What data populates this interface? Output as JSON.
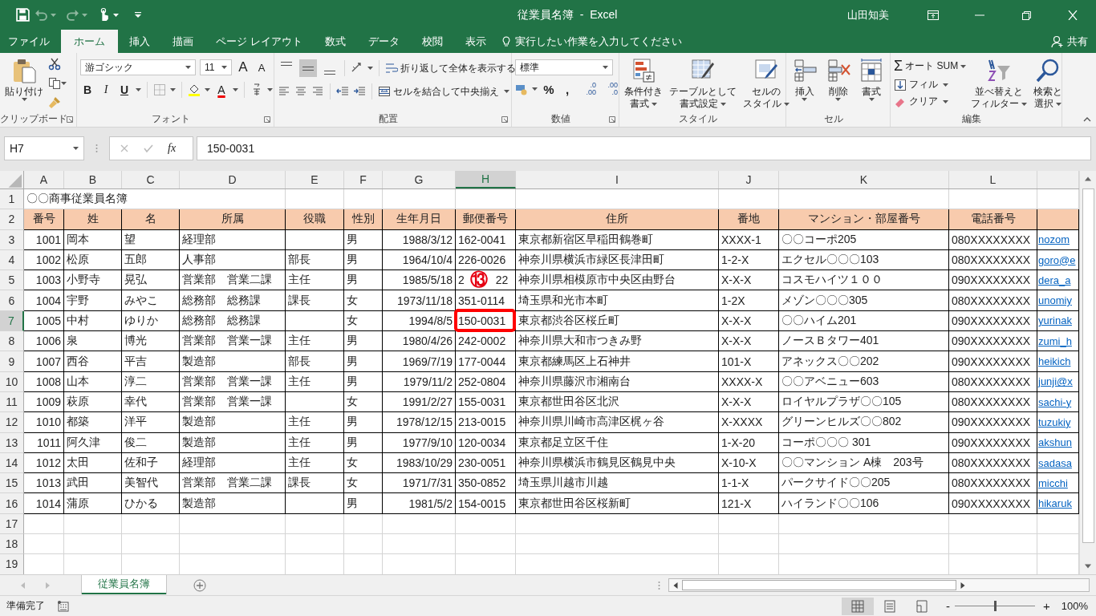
{
  "title_bar": {
    "title": "従業員名簿  -  Excel",
    "user": "山田知美"
  },
  "menu_tabs": [
    {
      "label": "ファイル",
      "selected": false
    },
    {
      "label": "ホーム",
      "selected": true
    },
    {
      "label": "挿入",
      "selected": false
    },
    {
      "label": "描画",
      "selected": false
    },
    {
      "label": "ページ レイアウト",
      "selected": false
    },
    {
      "label": "数式",
      "selected": false
    },
    {
      "label": "データ",
      "selected": false
    },
    {
      "label": "校閲",
      "selected": false
    },
    {
      "label": "表示",
      "selected": false
    }
  ],
  "tell_me": {
    "placeholder": "実行したい作業を入力してください"
  },
  "share": "共有",
  "ribbon": {
    "clipboard": {
      "label": "クリップボード",
      "paste": "貼り付け"
    },
    "font": {
      "label": "フォント",
      "face": "游ゴシック",
      "size": "11",
      "grow": "A",
      "shrink": "A",
      "bold": "B",
      "italic": "I",
      "underline": "U",
      "color_letter": "A"
    },
    "alignment": {
      "label": "配置",
      "vertical_align_buttons": [
        {
          "selected": false
        },
        {
          "selected": true
        },
        {
          "selected": false
        }
      ],
      "wrap": "折り返して全体を表示する",
      "merge": "セルを結合して中央揃え"
    },
    "number": {
      "label": "数値",
      "format": "標準",
      "percent": "%",
      "comma": ",",
      "increase_decimal": [
        ".0",
        ".00"
      ],
      "decrease_decimal": [
        ".00",
        ".0"
      ]
    },
    "styles": {
      "label": "スタイル",
      "conditional": [
        "条件付き",
        "書式"
      ],
      "table": [
        "テーブルとして",
        "書式設定"
      ],
      "cell_styles": [
        "セルの",
        "スタイル"
      ]
    },
    "cells": {
      "label": "セル",
      "insert": "挿入",
      "delete": "削除",
      "format": "書式"
    },
    "editing": {
      "label": "編集",
      "sigma": "Σ",
      "autosum": "オート SUM",
      "fill": "フィル",
      "clear": "クリア",
      "sort": [
        "並べ替えと",
        "フィルター"
      ],
      "find": [
        "検索と",
        "選択"
      ]
    }
  },
  "formula_bar": {
    "name_box": "H7",
    "fx": "fx",
    "value": "150-0031"
  },
  "columns": [
    {
      "label": "A",
      "selected": false
    },
    {
      "label": "B",
      "selected": false
    },
    {
      "label": "C",
      "selected": false
    },
    {
      "label": "D",
      "selected": false
    },
    {
      "label": "E",
      "selected": false
    },
    {
      "label": "F",
      "selected": false
    },
    {
      "label": "G",
      "selected": false
    },
    {
      "label": "H",
      "selected": true
    },
    {
      "label": "I",
      "selected": false
    },
    {
      "label": "J",
      "selected": false
    },
    {
      "label": "K",
      "selected": false
    },
    {
      "label": "L",
      "selected": false
    }
  ],
  "row_numbers": [
    {
      "label": "1",
      "selected": false
    },
    {
      "label": "2",
      "selected": false
    },
    {
      "label": "3",
      "selected": false
    },
    {
      "label": "4",
      "selected": false
    },
    {
      "label": "5",
      "selected": false
    },
    {
      "label": "6",
      "selected": false
    },
    {
      "label": "7",
      "selected": true
    },
    {
      "label": "8",
      "selected": false
    },
    {
      "label": "9",
      "selected": false
    },
    {
      "label": "10",
      "selected": false
    },
    {
      "label": "11",
      "selected": false
    },
    {
      "label": "12",
      "selected": false
    },
    {
      "label": "13",
      "selected": false
    },
    {
      "label": "14",
      "selected": false
    },
    {
      "label": "15",
      "selected": false
    },
    {
      "label": "16",
      "selected": false
    },
    {
      "label": "17",
      "selected": false
    },
    {
      "label": "18",
      "selected": false
    },
    {
      "label": "19",
      "selected": false
    }
  ],
  "sheet_title": "〇〇商事従業員名簿",
  "headers": [
    "番号",
    "姓",
    "名",
    "所属",
    "役職",
    "性別",
    "生年月日",
    "郵便番号",
    "住所",
    "番地",
    "マンション・部屋番号",
    "電話番号"
  ],
  "employees": [
    {
      "cells": [
        "1001",
        "岡本",
        "望",
        "経理部",
        null,
        "男",
        "1988/3/12",
        "162-0041",
        "東京都新宿区早稲田鶴巻町",
        "XXXX-1",
        "〇〇コーポ205",
        "080XXXXXXXX",
        "nozom"
      ]
    },
    {
      "cells": [
        "1002",
        "松原",
        "五郎",
        "人事部",
        "部長",
        "男",
        "1964/10/4",
        "226-0026",
        "神奈川県横浜市緑区長津田町",
        "1-2-X",
        "エクセル〇〇〇103",
        "080XXXXXXXX",
        "goro@e"
      ]
    },
    {
      "cells": [
        "1003",
        "小野寺",
        "晃弘",
        "営業部　営業二課",
        "主任",
        "男",
        "1985/5/18",
        "2          22",
        "神奈川県相模原市中央区由野台",
        "X-X-X",
        "コスモハイツ１００",
        "090XXXXXXXX",
        "dera_a"
      ]
    },
    {
      "cells": [
        "1004",
        "宇野",
        "みやこ",
        "総務部　総務課",
        "課長",
        "女",
        "1973/11/18",
        "351-0114",
        "埼玉県和光市本町",
        "1-2X",
        "メゾン〇〇〇305",
        "080XXXXXXXX",
        "unomiy"
      ]
    },
    {
      "cells": [
        "1005",
        "中村",
        "ゆりか",
        "総務部　総務課",
        null,
        "女",
        "1994/8/5",
        "150-0031",
        "東京都渋谷区桜丘町",
        "X-X-X",
        "〇〇ハイム201",
        "090XXXXXXXX",
        "yurinak"
      ]
    },
    {
      "cells": [
        "1006",
        "泉",
        "博光",
        "営業部　営業一課",
        "主任",
        "男",
        "1980/4/26",
        "242-0002",
        "神奈川県大和市つきみ野",
        "X-X-X",
        "ノースＢタワー401",
        "090XXXXXXXX",
        "zumi_h"
      ]
    },
    {
      "cells": [
        "1007",
        "西谷",
        "平吉",
        "製造部",
        "部長",
        "男",
        "1969/7/19",
        "177-0044",
        "東京都練馬区上石神井",
        "101-X",
        "アネックス〇〇202",
        "090XXXXXXXX",
        "heikich"
      ]
    },
    {
      "cells": [
        "1008",
        "山本",
        "淳二",
        "営業部　営業一課",
        "主任",
        "男",
        "1979/11/2",
        "252-0804",
        "神奈川県藤沢市湘南台",
        "XXXX-X",
        "〇〇アベニュー603",
        "080XXXXXXXX",
        "junji@x"
      ]
    },
    {
      "cells": [
        "1009",
        "萩原",
        "幸代",
        "営業部　営業一課",
        null,
        "女",
        "1991/2/27",
        "155-0031",
        "東京都世田谷区北沢",
        "X-X-X",
        "ロイヤルプラザ〇〇105",
        "080XXXXXXXX",
        "sachi-y"
      ]
    },
    {
      "cells": [
        "1010",
        "都築",
        "洋平",
        "製造部",
        "主任",
        "男",
        "1978/12/15",
        "213-0015",
        "神奈川県川崎市高津区梶ヶ谷",
        "X-XXXX",
        "グリーンヒルズ〇〇802",
        "090XXXXXXXX",
        "tuzukiy"
      ]
    },
    {
      "cells": [
        "1011",
        "阿久津",
        "俊二",
        "製造部",
        "主任",
        "男",
        "1977/9/10",
        "120-0034",
        "東京都足立区千住",
        "1-X-20",
        "コーポ〇〇〇 301",
        "090XXXXXXXX",
        "akshun"
      ]
    },
    {
      "cells": [
        "1012",
        "太田",
        "佐和子",
        "経理部",
        "主任",
        "女",
        "1983/10/29",
        "230-0051",
        "神奈川県横浜市鶴見区鶴見中央",
        "X-10-X",
        "〇〇マンション A棟　203号",
        "080XXXXXXXX",
        "sadasa"
      ]
    },
    {
      "cells": [
        "1013",
        "武田",
        "美智代",
        "営業部　営業二課",
        "課長",
        "女",
        "1971/7/31",
        "350-0852",
        "埼玉県川越市川越",
        "1-1-X",
        "パークサイド〇〇205",
        "080XXXXXXXX",
        "micchi"
      ]
    },
    {
      "cells": [
        "1014",
        "蒲原",
        "ひかる",
        "製造部",
        null,
        "男",
        "1981/5/2",
        "154-0015",
        "東京都世田谷区桜新町",
        "121-X",
        "ハイランド〇〇106",
        "090XXXXXXXX",
        "hikaruk"
      ]
    }
  ],
  "annotation": {
    "number": "⑬"
  },
  "sheet_tabs": [
    {
      "label": "従業員名簿",
      "selected": true
    }
  ],
  "status_bar": {
    "status": "準備完了",
    "zoom_out": "-",
    "zoom_in": "+",
    "zoom": {
      "level": 0.5,
      "reading": "100%"
    }
  }
}
